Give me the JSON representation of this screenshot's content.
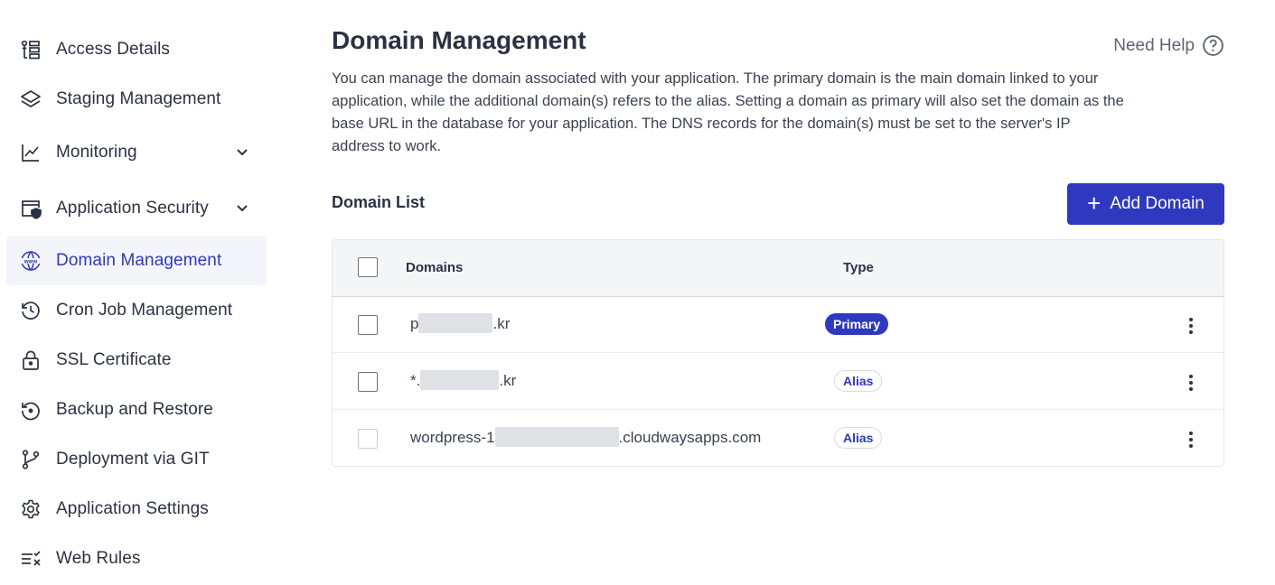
{
  "sidebar": {
    "items": [
      {
        "label": "Access Details",
        "icon": "access-details-icon"
      },
      {
        "label": "Staging Management",
        "icon": "layers-icon"
      },
      {
        "label": "Monitoring",
        "icon": "chart-line-icon",
        "expandable": true
      },
      {
        "label": "Application Security",
        "icon": "browser-shield-icon",
        "expandable": true
      },
      {
        "label": "Domain Management",
        "icon": "www-globe-icon",
        "active": true
      },
      {
        "label": "Cron Job Management",
        "icon": "history-clock-icon"
      },
      {
        "label": "SSL Certificate",
        "icon": "lock-icon"
      },
      {
        "label": "Backup and Restore",
        "icon": "restore-icon"
      },
      {
        "label": "Deployment via GIT",
        "icon": "git-branch-icon"
      },
      {
        "label": "Application Settings",
        "icon": "gear-icon"
      },
      {
        "label": "Web Rules",
        "icon": "list-x-icon"
      }
    ]
  },
  "header": {
    "title": "Domain Management",
    "help_label": "Need Help",
    "description": "You can manage the domain associated with your application. The primary domain is the main domain linked to your application, while the additional domain(s) refers to the alias. Setting a domain as primary will also set the domain as the base URL in the database for your application. The DNS records for the domain(s) must be set to the server's IP address to work."
  },
  "domain_list": {
    "title": "Domain List",
    "add_button_label": "Add Domain",
    "columns": [
      "Domains",
      "Type"
    ],
    "rows": [
      {
        "prefix": "p",
        "suffix": ".kr",
        "type": "Primary"
      },
      {
        "prefix": "*.",
        "suffix": ".kr",
        "type": "Alias"
      },
      {
        "prefix": "wordpress-1",
        "suffix": ".cloudwaysapps.com",
        "type": "Alias"
      }
    ]
  },
  "colors": {
    "accent": "#2f39bf",
    "active_bg": "#f3f5fa",
    "text": "#2b3242"
  }
}
